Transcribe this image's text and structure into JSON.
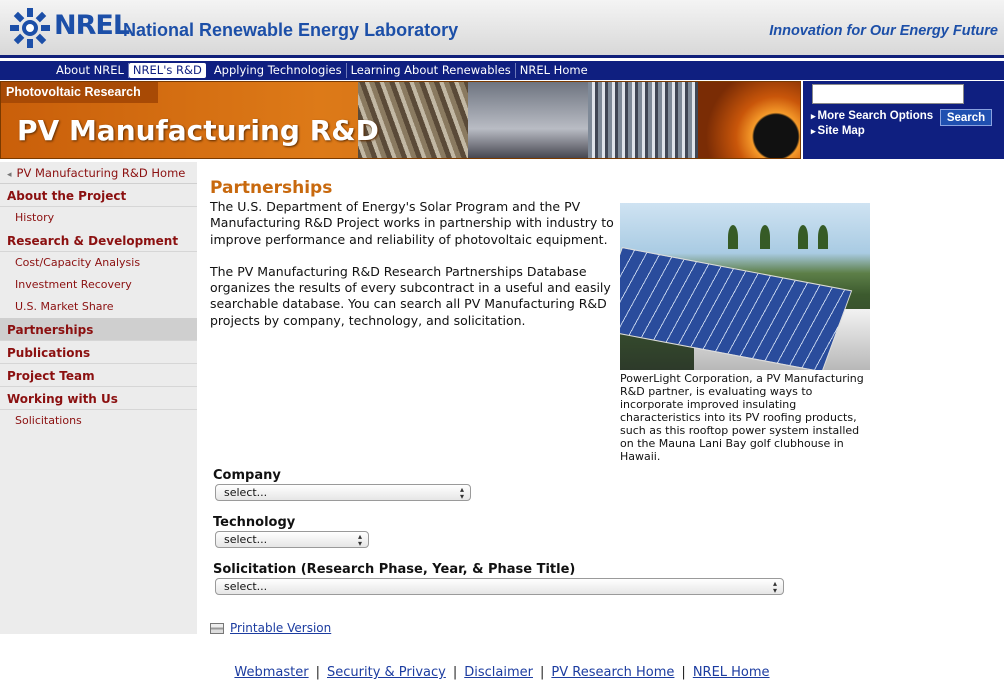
{
  "header": {
    "logo_text": "NREL",
    "lab_name": "National Renewable Energy Laboratory",
    "tagline": "Innovation for Our Energy Future"
  },
  "topnav": [
    {
      "label": "About NREL",
      "active": false
    },
    {
      "label": "NREL's R&D",
      "active": true
    },
    {
      "label": "Applying Technologies",
      "active": false
    },
    {
      "label": "Learning About Renewables",
      "active": false
    },
    {
      "label": "NREL Home",
      "active": false
    }
  ],
  "banner": {
    "kicker": "Photovoltaic Research",
    "title": "PV Manufacturing R&D"
  },
  "search": {
    "placeholder": "",
    "more_options": "More Search Options",
    "site_map": "Site Map",
    "button": "Search"
  },
  "sidebar": {
    "home": "PV Manufacturing R&D Home",
    "items": [
      {
        "label": "About the Project",
        "type": "section"
      },
      {
        "label": "History",
        "type": "sub"
      },
      {
        "label": "Research & Development",
        "type": "section"
      },
      {
        "label": "Cost/Capacity Analysis",
        "type": "sub"
      },
      {
        "label": "Investment Recovery",
        "type": "sub"
      },
      {
        "label": "U.S. Market Share",
        "type": "sub"
      },
      {
        "label": "Partnerships",
        "type": "section",
        "active": true
      },
      {
        "label": "Publications",
        "type": "section"
      },
      {
        "label": "Project Team",
        "type": "section"
      },
      {
        "label": "Working with Us",
        "type": "section"
      },
      {
        "label": "Solicitations",
        "type": "sub"
      }
    ]
  },
  "main": {
    "title": "Partnerships",
    "paragraphs": [
      "The U.S. Department of Energy's Solar Program and the PV Manufacturing R&D Project works in partnership with industry to improve performance and reliability of photovoltaic equipment.",
      "The PV Manufacturing R&D Research Partnerships Database organizes the results of every subcontract in a useful and easily searchable database. You can search all PV Manufacturing R&D projects by company, technology, and solicitation."
    ],
    "caption": "PowerLight Corporation, a PV Manufacturing R&D partner, is evaluating ways to incorporate improved insulating characteristics into its PV roofing products, such as this rooftop power system installed on the Mauna Lani Bay golf clubhouse in Hawaii.",
    "company_label": "Company",
    "company_value": "select...",
    "technology_label": "Technology",
    "technology_value": "select...",
    "solicitation_label": "Solicitation (Research Phase, Year, & Phase Title)",
    "solicitation_value": "select...",
    "printable": "Printable Version"
  },
  "footer": {
    "links": [
      "Webmaster",
      "Security & Privacy",
      "Disclaimer",
      "PV Research Home",
      "NREL Home"
    ],
    "separator": "|"
  },
  "colors": {
    "navy": "#0f1f80",
    "brand_blue": "#1c4fa8",
    "orange": "#c8690e",
    "sidebar_red": "#8b1010"
  }
}
